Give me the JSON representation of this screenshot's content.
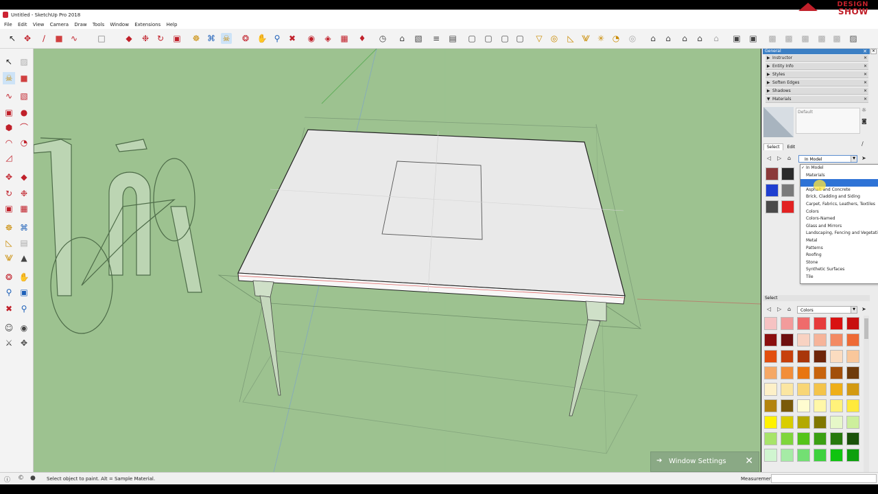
{
  "window": {
    "title": "Untitled - SketchUp Pro 2018",
    "logo_line1": "DESIGN",
    "logo_line2": "SHOW"
  },
  "menu": [
    "File",
    "Edit",
    "View",
    "Camera",
    "Draw",
    "Tools",
    "Window",
    "Extensions",
    "Help"
  ],
  "tray": {
    "header": "General",
    "sections": [
      "Instructor",
      "Entity Info",
      "Styles",
      "Soften Edges",
      "Shadows",
      "Materials"
    ],
    "material_name": "Default",
    "tabs": {
      "select": "Select",
      "edit": "Edit"
    },
    "library_selected": "In Model",
    "library_options": [
      "In Model",
      "Materials",
      "",
      "Asphalt and Concrete",
      "Brick, Cladding and Siding",
      "Carpet, Fabrics, Leathers, Textiles",
      "Colors",
      "Colors-Named",
      "Glass and Mirrors",
      "Landscaping, Fencing and Vegetation",
      "Metal",
      "Patterns",
      "Roofing",
      "Stone",
      "Synthetic Surfaces",
      "Tile"
    ],
    "highlighted_index": 2,
    "select_header": "Select",
    "secondary_library": "Colors"
  },
  "model_swatches": [
    "#8b3a3a",
    "#2a2a2a",
    "#1f3fd0",
    "#7a7a7a",
    "#4a4a4a",
    "#e22222"
  ],
  "color_swatches": [
    [
      "#f6c2c2",
      "#f29b9b",
      "#ef6b6b",
      "#e63b3b",
      "#d91111",
      "#c80f0f"
    ],
    [
      "#8b0f0f",
      "#6e0f0f",
      "#f8d2c2",
      "#f6b49a",
      "#f38a63",
      "#ee6a35"
    ],
    [
      "#e24e0f",
      "#c7400c",
      "#a9360a",
      "#6e250a",
      "#fbdcc0",
      "#f9c79b"
    ],
    [
      "#f5a865",
      "#f28e3a",
      "#e87510",
      "#c8640d",
      "#a24f0a",
      "#6e3a0a"
    ],
    [
      "#fdf0c8",
      "#fbe6a2",
      "#f8d676",
      "#f4c44a",
      "#efaf18",
      "#d39a12"
    ],
    [
      "#b3840f",
      "#7a5a0a",
      "#fffcd0",
      "#fff7a8",
      "#fff27a",
      "#ffea3c"
    ],
    [
      "#fff200",
      "#d9cd00",
      "#b3a900",
      "#807700",
      "#e6f7c8",
      "#cdef9c"
    ],
    [
      "#a8e46a",
      "#7fd63c",
      "#54c41a",
      "#3aa012",
      "#27790d",
      "#1a520a"
    ],
    [
      "#d0f5d0",
      "#a6eba6",
      "#73df73",
      "#3ed23e",
      "#10c410",
      "#0da00d"
    ]
  ],
  "window_settings": {
    "label": "Window Settings"
  },
  "status": {
    "message": "Select object to paint. Alt = Sample Material.",
    "measurements_label": "Measurements"
  }
}
